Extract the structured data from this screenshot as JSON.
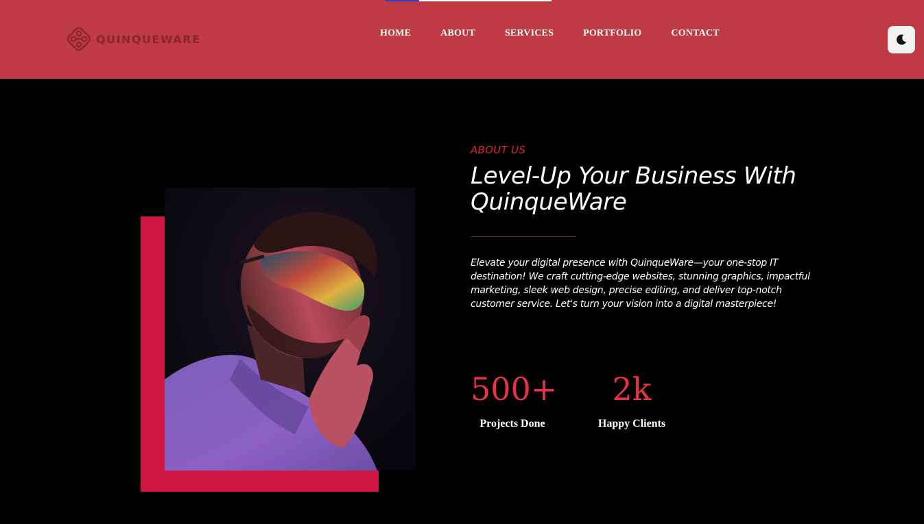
{
  "brand": {
    "name": "QUINQUEWARE",
    "logo_icon": "quinqueware-logo-icon"
  },
  "nav": {
    "items": [
      {
        "label": "HOME"
      },
      {
        "label": "ABOUT"
      },
      {
        "label": "SERVICES"
      },
      {
        "label": "PORTFOLIO"
      },
      {
        "label": "CONTACT"
      }
    ]
  },
  "theme_toggle": {
    "icon": "moon-icon"
  },
  "about": {
    "eyebrow": "ABOUT US",
    "headline_line1": "Level-Up Your Business With",
    "headline_line2": "QuinqueWare",
    "description": "Elevate your digital presence with QuinqueWare—your one-stop IT destination! We craft cutting-edge websites, stunning graphics, impactful marketing, sleek web design, precise editing, and deliver top-notch customer service. Let's turn your vision into a digital masterpiece!",
    "stats": [
      {
        "value": "500+",
        "label": "Projects Done"
      },
      {
        "value": "2k",
        "label": "Happy Clients"
      }
    ]
  },
  "colors": {
    "header_bg": "#be3a45",
    "accent_red": "#e63446",
    "block_red": "#cf1542",
    "page_bg": "#000000"
  }
}
